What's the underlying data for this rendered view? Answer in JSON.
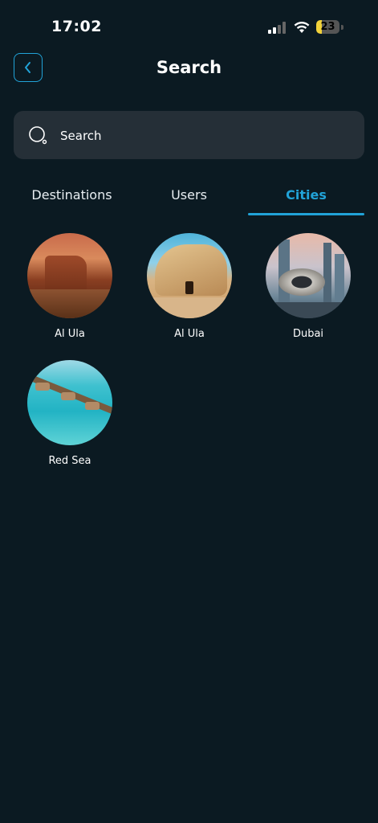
{
  "status_bar": {
    "time": "17:02",
    "battery": "23"
  },
  "header": {
    "title": "Search"
  },
  "search": {
    "placeholder": "Search"
  },
  "tabs": [
    {
      "label": "Destinations"
    },
    {
      "label": "Users"
    },
    {
      "label": "Cities",
      "active": true
    }
  ],
  "cities": [
    {
      "name": "Al Ula"
    },
    {
      "name": "Al Ula"
    },
    {
      "name": "Dubai"
    },
    {
      "name": "Red Sea"
    }
  ],
  "colors": {
    "accent": "#21a3d8",
    "background": "#0b1a22",
    "search_bg": "#252f37"
  }
}
